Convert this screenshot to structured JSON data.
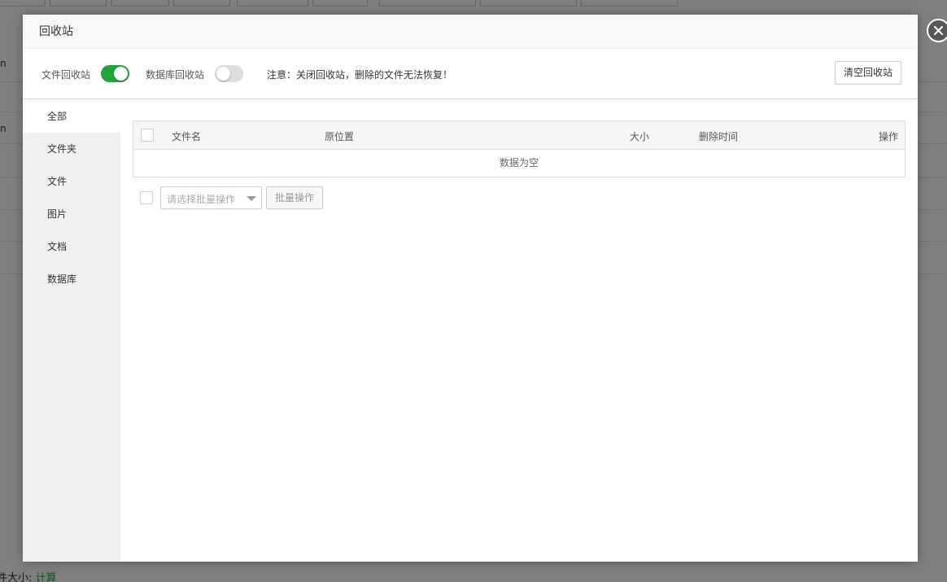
{
  "background": {
    "footer_label": "件大小:",
    "footer_link": "计算",
    "row_fragments": [
      "n",
      "n"
    ]
  },
  "dialog": {
    "title": "回收站",
    "toolbar": {
      "file_recycle_label": "文件回收站",
      "file_recycle_enabled": true,
      "db_recycle_label": "数据库回收站",
      "db_recycle_enabled": false,
      "notice": "注意：关闭回收站，删除的文件无法恢复！",
      "clear_button": "清空回收站"
    },
    "sidebar": {
      "items": [
        {
          "label": "全部",
          "active": true
        },
        {
          "label": "文件夹",
          "active": false
        },
        {
          "label": "文件",
          "active": false
        },
        {
          "label": "图片",
          "active": false
        },
        {
          "label": "文档",
          "active": false
        },
        {
          "label": "数据库",
          "active": false
        }
      ]
    },
    "table": {
      "columns": {
        "name": "文件名",
        "location": "原位置",
        "size": "大小",
        "deleted_time": "删除时间",
        "actions": "操作"
      },
      "empty_text": "数据为空"
    },
    "batch": {
      "select_placeholder": "请选择批量操作",
      "button": "批量操作"
    }
  },
  "colors": {
    "accent": "#20a53a",
    "overlay": "#7f7f7f"
  }
}
